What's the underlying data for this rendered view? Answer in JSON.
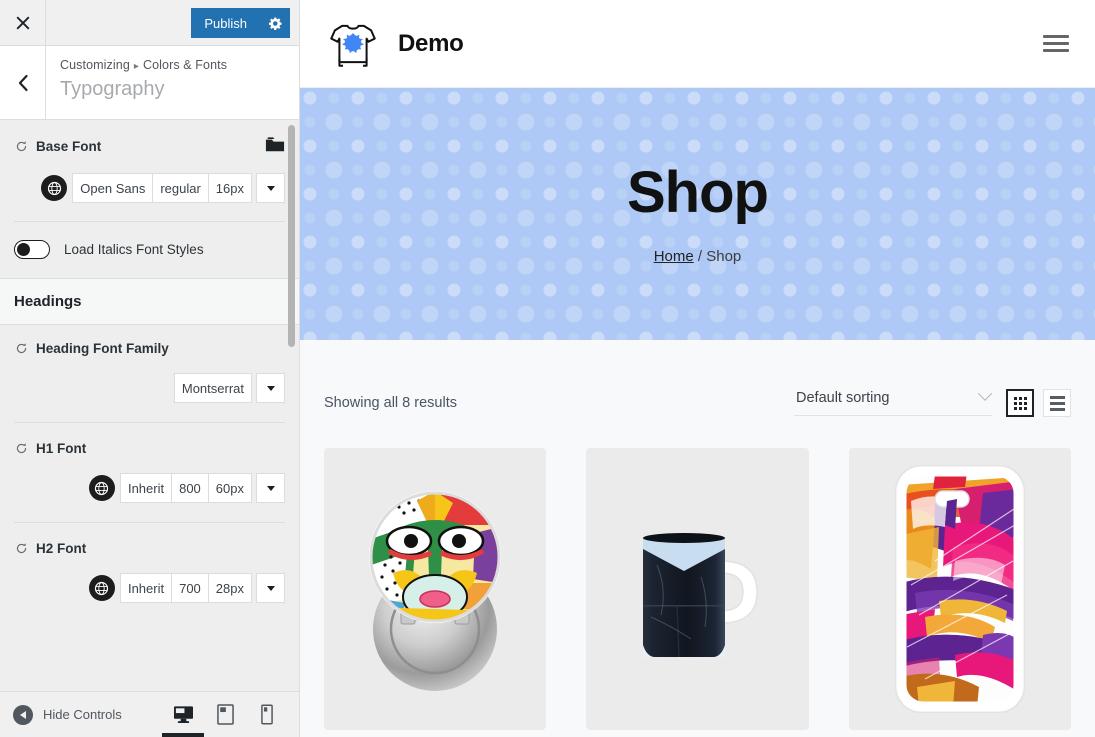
{
  "customizer": {
    "topbar": {
      "close_icon": "close-icon",
      "publish_label": "Publish",
      "gear_icon": "gear-icon"
    },
    "panel_header": {
      "back_icon": "chevron-left-icon",
      "breadcrumb_root": "Customizing",
      "breadcrumb_sep": "▸",
      "breadcrumb_parent": "Colors & Fonts",
      "title": "Typography"
    },
    "controls": [
      {
        "label": "Base Font",
        "reset_icon": "reset-icon",
        "folder_icon": "folder-icon",
        "globe_icon": "globe-icon",
        "family": "Open Sans",
        "weight": "regular",
        "size": "16px",
        "caret_icon": "caret-down-icon"
      },
      {
        "label": "Heading Font Family",
        "reset_icon": "reset-icon",
        "family": "Montserrat",
        "caret_icon": "caret-down-icon"
      },
      {
        "label": "H1 Font",
        "reset_icon": "reset-icon",
        "globe_icon": "globe-icon",
        "family": "Inherit",
        "weight": "800",
        "size": "60px",
        "caret_icon": "caret-down-icon"
      },
      {
        "label": "H2 Font",
        "reset_icon": "reset-icon",
        "globe_icon": "globe-icon",
        "family": "Inherit",
        "weight": "700",
        "size": "28px",
        "caret_icon": "caret-down-icon"
      }
    ],
    "italics_toggle": {
      "label": "Load Italics Font Styles",
      "state": "off"
    },
    "headings_section": "Headings",
    "footer": {
      "hide_controls_label": "Hide Controls",
      "hide_icon": "collapse-left-icon",
      "devices": [
        {
          "name": "desktop-preview",
          "icon": "desktop-icon",
          "active": true
        },
        {
          "name": "tablet-preview",
          "icon": "tablet-icon",
          "active": false
        },
        {
          "name": "mobile-preview",
          "icon": "mobile-icon",
          "active": false
        }
      ]
    },
    "colors": {
      "publish_blue": "#2271b1",
      "panel_bg": "#eeeeee",
      "bar_bg": "#f0f0f1"
    }
  },
  "preview": {
    "header": {
      "logo_icon": "tshirt-splat-logo-icon",
      "site_title": "Demo",
      "menu_icon": "hamburger-menu-icon"
    },
    "hero": {
      "title": "Shop",
      "breadcrumb_home": "Home",
      "breadcrumb_separator": "/",
      "breadcrumb_current": "Shop",
      "bg_color": "#aec9f5"
    },
    "shop": {
      "result_count": "Showing all 8 results",
      "sorting_value": "Default sorting",
      "sorting_chevron": "chevron-down-icon",
      "grid_view_icon": "grid-view-icon",
      "list_view_icon": "list-view-icon",
      "active_view": "grid",
      "products": [
        {
          "name": "pin-badge-product",
          "alt": "Abstract face pin badge"
        },
        {
          "name": "mug-product",
          "alt": "Dark navy wrap coffee mug"
        },
        {
          "name": "phone-case-product",
          "alt": "Abstract paint phone case"
        }
      ]
    }
  }
}
